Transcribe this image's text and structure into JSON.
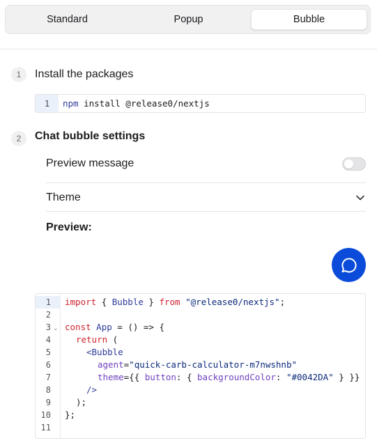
{
  "tabs": [
    {
      "label": "Standard",
      "active": false
    },
    {
      "label": "Popup",
      "active": false
    },
    {
      "label": "Bubble",
      "active": true
    }
  ],
  "steps": [
    {
      "number": "1",
      "title": "Install the packages"
    },
    {
      "number": "2",
      "title": "Chat bubble settings"
    }
  ],
  "install": {
    "line_number": "1",
    "cmd": "npm",
    "args": " install @release0/nextjs"
  },
  "settings": {
    "preview_message_label": "Preview message",
    "preview_message_enabled": false,
    "theme_label": "Theme",
    "preview_label": "Preview:"
  },
  "bubble": {
    "icon": "chat-bubble-icon",
    "color": "#0A4BD9"
  },
  "code": {
    "line_numbers": [
      "1",
      "2",
      "3",
      "4",
      "5",
      "6",
      "7",
      "8",
      "9",
      "10",
      "11"
    ],
    "l1": {
      "kw": "import",
      "a": " { ",
      "id": "Bubble",
      "b": " } ",
      "kw2": "from",
      "c": " ",
      "str": "\"@release0/nextjs\"",
      "d": ";"
    },
    "l3": {
      "kw": "const",
      "a": " ",
      "id": "App",
      "b": " = () => {"
    },
    "l4": {
      "kw": "return",
      "a": " ("
    },
    "l5": {
      "tag": "<Bubble"
    },
    "l6": {
      "attr": "agent",
      "a": "=",
      "str": "\"quick-carb-calculator-m7nwshnb\""
    },
    "l7": {
      "attr": "theme",
      "a": "={{ ",
      "key": "button",
      "b": ": { ",
      "key2": "backgroundColor",
      "c": ": ",
      "str": "\"#0042DA\"",
      "d": " } }}"
    },
    "l8": {
      "tag": "/>"
    },
    "l9": {
      "a": ");"
    },
    "l10": {
      "a": "};"
    }
  }
}
